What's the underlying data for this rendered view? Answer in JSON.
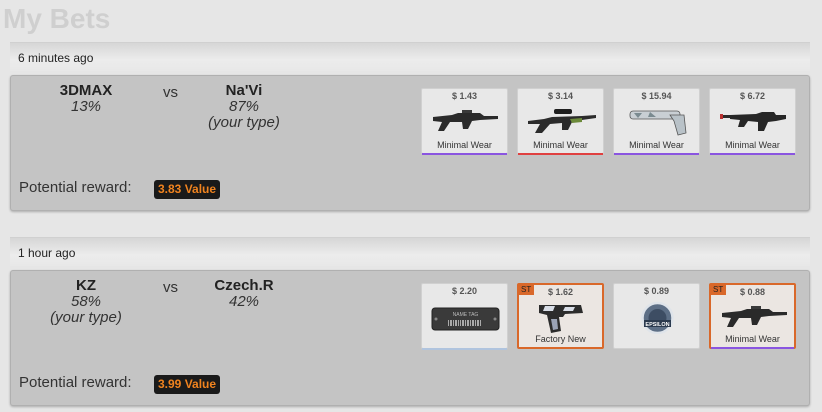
{
  "page": {
    "title": "My Bets"
  },
  "bets": [
    {
      "time": "6 minutes ago",
      "team_left": {
        "name": "3DMAX",
        "pct": "13%",
        "note": ""
      },
      "vs": "vs",
      "team_right": {
        "name": "Na'Vi",
        "pct": "87%",
        "note": "(your type)"
      },
      "reward_label": "Potential reward:",
      "reward_value": "3.83 Value",
      "items": [
        {
          "price": "$ 1.43",
          "wear": "Minimal Wear",
          "icon": "rifle-famas-icon",
          "line_color": "#8a55e0",
          "st": ""
        },
        {
          "price": "$ 3.14",
          "wear": "Minimal Wear",
          "icon": "rifle-scoped-icon",
          "line_color": "#e04040",
          "st": ""
        },
        {
          "price": "$ 15.94",
          "wear": "Minimal Wear",
          "icon": "pistol-silenced-icon",
          "line_color": "#8a55e0",
          "st": ""
        },
        {
          "price": "$ 6.72",
          "wear": "Minimal Wear",
          "icon": "rifle-m4-icon",
          "line_color": "#8a55e0",
          "st": ""
        }
      ]
    },
    {
      "time": "1 hour ago",
      "team_left": {
        "name": "KZ",
        "pct": "58%",
        "note": "(your type)"
      },
      "vs": "vs",
      "team_right": {
        "name": "Czech.R",
        "pct": "42%",
        "note": ""
      },
      "reward_label": "Potential reward:",
      "reward_value": "3.99 Value",
      "items": [
        {
          "price": "$ 2.20",
          "wear": "",
          "icon": "name-tag-icon",
          "line_color": "#b0c4de",
          "st": "",
          "tag_text": "NAME TAG"
        },
        {
          "price": "$ 1.62",
          "wear": "Factory New",
          "icon": "pistol-icon",
          "line_color": "#d9682a",
          "st": "ST"
        },
        {
          "price": "$ 0.89",
          "wear": "",
          "icon": "epsilon-sticker-icon",
          "line_color": "#d0d0d0",
          "st": "",
          "sticker_text": "EPSILON"
        },
        {
          "price": "$ 0.88",
          "wear": "Minimal Wear",
          "icon": "rifle-famas-icon",
          "line_color": "#8a55e0",
          "st": "ST"
        }
      ]
    }
  ],
  "colors": {
    "reward_text": "#f0831f",
    "stattrak": "#d9682a",
    "box_bg": "#c4c4c4"
  }
}
